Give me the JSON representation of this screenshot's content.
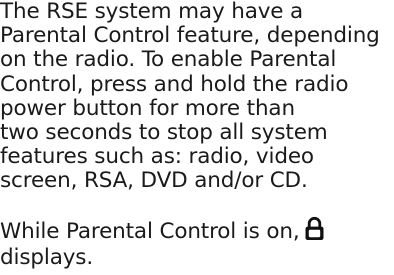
{
  "document": {
    "paragraph1": [
      "The RSE system may have a",
      "Parental Control feature, depending",
      "on the radio. To enable Parental",
      "Control, press and hold the radio",
      "power button for more than",
      "two seconds to stop all system",
      "features such as: radio, video",
      "screen, RSA, DVD and/or CD."
    ],
    "paragraph2": {
      "before_icon": "While Parental Control is on,",
      "after_icon": "displays."
    },
    "icon": "lock-icon",
    "colors": {
      "text": "#1a1a1a",
      "background": "#ffffff"
    }
  }
}
